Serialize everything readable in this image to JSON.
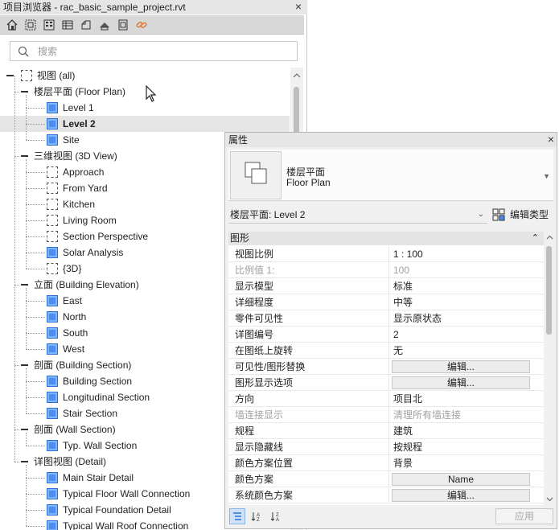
{
  "project_browser": {
    "title": "项目浏览器 - rac_basic_sample_project.rvt",
    "close": "×",
    "search_placeholder": "搜索",
    "tree": [
      {
        "label": "视图 (all)",
        "level": 0,
        "toggle": true,
        "icon": "views-root"
      },
      {
        "label": "楼层平面 (Floor Plan)",
        "level": 1,
        "toggle": true
      },
      {
        "label": "Level 1",
        "level": 2,
        "icon": "plan"
      },
      {
        "label": "Level 2",
        "level": 2,
        "icon": "plan",
        "selected": true
      },
      {
        "label": "Site",
        "level": 2,
        "icon": "plan"
      },
      {
        "label": "三维视图 (3D View)",
        "level": 1,
        "toggle": true
      },
      {
        "label": "Approach",
        "level": 2,
        "icon": "dash"
      },
      {
        "label": "From Yard",
        "level": 2,
        "icon": "dash"
      },
      {
        "label": "Kitchen",
        "level": 2,
        "icon": "dash"
      },
      {
        "label": "Living Room",
        "level": 2,
        "icon": "dash"
      },
      {
        "label": "Section Perspective",
        "level": 2,
        "icon": "dash"
      },
      {
        "label": "Solar Analysis",
        "level": 2,
        "icon": "plan"
      },
      {
        "label": "{3D}",
        "level": 2,
        "icon": "dash"
      },
      {
        "label": "立面 (Building Elevation)",
        "level": 1,
        "toggle": true
      },
      {
        "label": "East",
        "level": 2,
        "icon": "plan"
      },
      {
        "label": "North",
        "level": 2,
        "icon": "plan"
      },
      {
        "label": "South",
        "level": 2,
        "icon": "plan"
      },
      {
        "label": "West",
        "level": 2,
        "icon": "plan"
      },
      {
        "label": "剖面 (Building Section)",
        "level": 1,
        "toggle": true
      },
      {
        "label": "Building Section",
        "level": 2,
        "icon": "plan"
      },
      {
        "label": "Longitudinal Section",
        "level": 2,
        "icon": "plan"
      },
      {
        "label": "Stair Section",
        "level": 2,
        "icon": "plan"
      },
      {
        "label": "剖面 (Wall Section)",
        "level": 1,
        "toggle": true
      },
      {
        "label": "Typ. Wall Section",
        "level": 2,
        "icon": "plan"
      },
      {
        "label": "详图视图 (Detail)",
        "level": 1,
        "toggle": true
      },
      {
        "label": "Main Stair Detail",
        "level": 2,
        "icon": "plan"
      },
      {
        "label": "Typical Floor Wall Connection",
        "level": 2,
        "icon": "plan"
      },
      {
        "label": "Typical Foundation Detail",
        "level": 2,
        "icon": "plan"
      },
      {
        "label": "Typical Wall Roof Connection",
        "level": 2,
        "icon": "plan"
      }
    ]
  },
  "properties": {
    "title": "属性",
    "close": "×",
    "type_name_cn": "楼层平面",
    "type_name_en": "Floor Plan",
    "instance_selector": "楼层平面: Level 2",
    "edit_type_label": "编辑类型",
    "group_label": "图形",
    "rows": [
      {
        "name": "视图比例",
        "value": "1 : 100"
      },
      {
        "name": "比例值 1:",
        "value": "100",
        "dim": true
      },
      {
        "name": "显示模型",
        "value": "标准"
      },
      {
        "name": "详细程度",
        "value": "中等"
      },
      {
        "name": "零件可见性",
        "value": "显示原状态"
      },
      {
        "name": "详图编号",
        "value": "2"
      },
      {
        "name": "在图纸上旋转",
        "value": "无"
      },
      {
        "name": "可见性/图形替换",
        "value": "编辑...",
        "button": true
      },
      {
        "name": "图形显示选项",
        "value": "编辑...",
        "button": true
      },
      {
        "name": "方向",
        "value": "项目北"
      },
      {
        "name": "墙连接显示",
        "value": "清理所有墙连接",
        "dim": true
      },
      {
        "name": "规程",
        "value": "建筑"
      },
      {
        "name": "显示隐藏线",
        "value": "按规程"
      },
      {
        "name": "颜色方案位置",
        "value": "背景"
      },
      {
        "name": "颜色方案",
        "value": "Name",
        "button": true
      },
      {
        "name": "系统颜色方案",
        "value": "编辑...",
        "button": true
      }
    ],
    "apply_label": "应用"
  }
}
